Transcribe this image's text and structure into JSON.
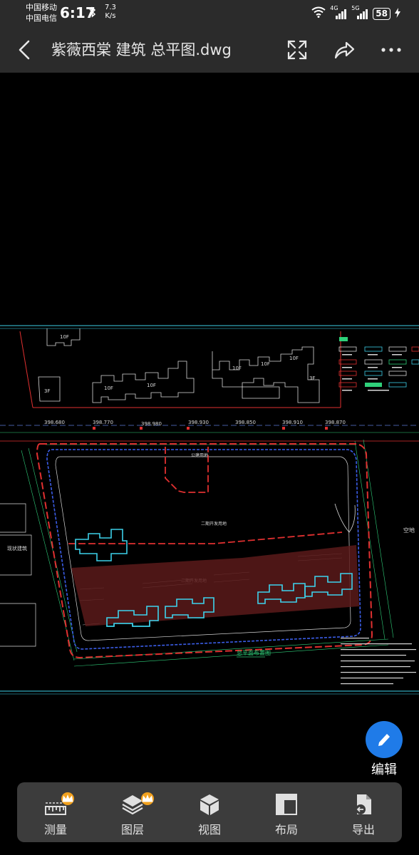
{
  "status_bar": {
    "carrier_1": "中国移动",
    "carrier_2": "中国电信",
    "time": "6:17",
    "speed_value": "7.3",
    "speed_unit": "K/s",
    "network_1": "4G",
    "network_2": "5G",
    "battery": "58"
  },
  "header": {
    "title": "紫薇西棠 建筑 总平图.dwg",
    "icons": [
      "back-icon",
      "fullscreen-icon",
      "share-icon",
      "more-icon"
    ]
  },
  "drawing": {
    "coords": [
      "398.680",
      "398.770",
      "398.980",
      "398.930",
      "398.850",
      "398.910",
      "398.870"
    ],
    "labels": {
      "floor_10f": "10F",
      "floor_3f": "3F",
      "existing_building": "现状建筑",
      "open_land": "空地",
      "plan_title": "总平面布置图",
      "phase_2_land": "二期开发用地",
      "public_land": "公建用地"
    }
  },
  "fab": {
    "label": "编辑",
    "icon": "pen-icon",
    "color": "#1f7be8"
  },
  "toolbar": {
    "items": [
      {
        "label": "测量",
        "icon": "ruler-icon",
        "vip": true
      },
      {
        "label": "图层",
        "icon": "layers-icon",
        "vip": true
      },
      {
        "label": "视图",
        "icon": "cube-icon",
        "vip": false
      },
      {
        "label": "布局",
        "icon": "layout-icon",
        "vip": false
      },
      {
        "label": "导出",
        "icon": "export-icon",
        "vip": false
      }
    ],
    "vip_color": "#f2a11d"
  }
}
